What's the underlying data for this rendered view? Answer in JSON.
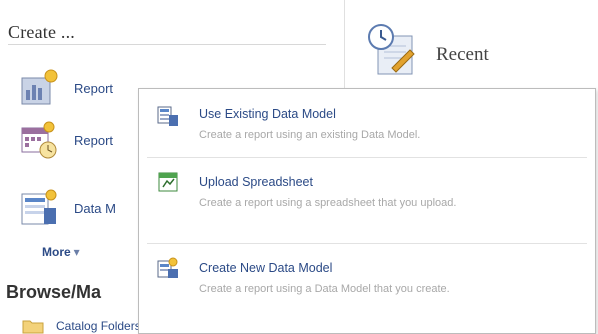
{
  "create": {
    "heading": "Create ...",
    "items": [
      {
        "label": "Report",
        "icon": "report-icon"
      },
      {
        "label": "Report",
        "icon": "report-job-icon"
      },
      {
        "label": "Data M",
        "icon": "data-model-icon"
      }
    ],
    "more_label": "More",
    "more_chevron": "▾"
  },
  "browse": {
    "heading": "Browse/Ma",
    "catalog_label": "Catalog Folders"
  },
  "recent": {
    "heading": "Recent",
    "icon": "recent-clock-icon"
  },
  "popup_menu": {
    "items": [
      {
        "title": "Use Existing Data Model",
        "description": "Create a report using an existing Data Model.",
        "icon": "data-model-table-icon"
      },
      {
        "title": "Upload Spreadsheet",
        "description": "Create a report using a spreadsheet that you upload.",
        "icon": "spreadsheet-icon"
      },
      {
        "title": "Create New Data Model",
        "description": "Create a report using a Data Model that you create.",
        "icon": "new-data-model-icon"
      }
    ]
  },
  "colors": {
    "link": "#2b4a86",
    "muted": "#a8a8a8",
    "heading": "#333333"
  }
}
